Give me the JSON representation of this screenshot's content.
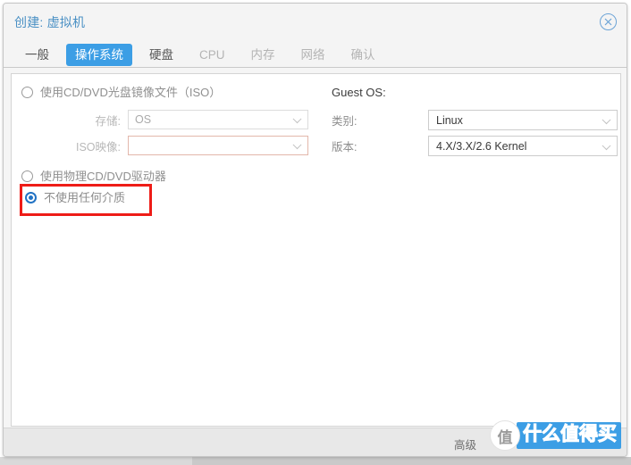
{
  "dialog": {
    "title": "创建: 虚拟机",
    "close_icon": "close-circle-icon"
  },
  "tabs": [
    {
      "label": "一般",
      "state": "normal"
    },
    {
      "label": "操作系统",
      "state": "active"
    },
    {
      "label": "硬盘",
      "state": "normal"
    },
    {
      "label": "CPU",
      "state": "disabled"
    },
    {
      "label": "内存",
      "state": "disabled"
    },
    {
      "label": "网络",
      "state": "disabled"
    },
    {
      "label": "确认",
      "state": "disabled"
    }
  ],
  "media": {
    "option_iso": "使用CD/DVD光盘镜像文件（ISO）",
    "option_physical": "使用物理CD/DVD驱动器",
    "option_none": "不使用任何介质",
    "selected": "不使用任何介质",
    "storage_label": "存储:",
    "storage_value": "OS",
    "iso_label": "ISO映像:",
    "iso_value": "",
    "highlight_color": "#ee1c17"
  },
  "guest_os": {
    "title": "Guest OS:",
    "category_label": "类别:",
    "category_value": "Linux",
    "version_label": "版本:",
    "version_value": "4.X/3.X/2.6 Kernel"
  },
  "footer": {
    "advanced_label": "高级"
  },
  "watermark": {
    "circle_text": "值",
    "badge_text": "什么值得买"
  }
}
